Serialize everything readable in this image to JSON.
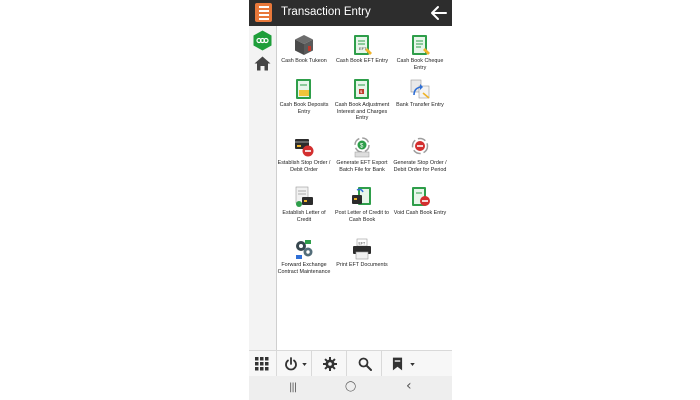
{
  "header": {
    "title": "Transaction Entry",
    "menu_icon": "hamburger-menu-icon",
    "back_icon": "back-arrow-icon",
    "accent": "#e8783a",
    "bar_color": "#2d2d2d"
  },
  "sidebar": {
    "items": [
      {
        "icon": "app-logo-icon",
        "color": "#1e9e3a"
      },
      {
        "icon": "home-icon"
      }
    ]
  },
  "tiles": [
    {
      "label": "Cash Book Tukeon",
      "icon": "cube-package-icon"
    },
    {
      "label": "Cash Book EFT Entry",
      "icon": "green-book-eft-icon"
    },
    {
      "label": "Cash Book Cheque Entry",
      "icon": "green-book-cheque-icon"
    },
    {
      "label": "Cash Book Deposits Entry",
      "icon": "green-book-deposit-icon"
    },
    {
      "label": "Cash Book Adjustment Interest and Charges Entry",
      "icon": "green-book-adjustment-icon"
    },
    {
      "label": "Bank Transfer Entry",
      "icon": "bank-transfer-icon"
    },
    {
      "label": "Establish Stop Order / Debit Order",
      "icon": "stop-order-card-icon"
    },
    {
      "label": "Generate EFT Export Batch File for Bank",
      "icon": "generate-eft-export-icon"
    },
    {
      "label": "Generate Stop Order / Debit Order for Period",
      "icon": "generate-stop-order-icon"
    },
    {
      "label": "Establish Letter of Credit",
      "icon": "letter-of-credit-icon"
    },
    {
      "label": "Post Letter of Credit to Cash Book",
      "icon": "post-letter-of-credit-icon"
    },
    {
      "label": "Void Cash Book Entry",
      "icon": "void-cash-book-icon"
    },
    {
      "label": "Forward Exchange Contract Maintenance",
      "icon": "forward-exchange-gears-icon"
    },
    {
      "label": "Print EFT Documents",
      "icon": "print-eft-icon"
    }
  ],
  "toolbar": {
    "items": [
      "apps-grid-icon",
      "power-icon",
      "settings-gear-icon",
      "search-icon",
      "bookmark-icon"
    ]
  },
  "navbar": {
    "recent": "|||",
    "home": "◯",
    "back": "‹"
  }
}
